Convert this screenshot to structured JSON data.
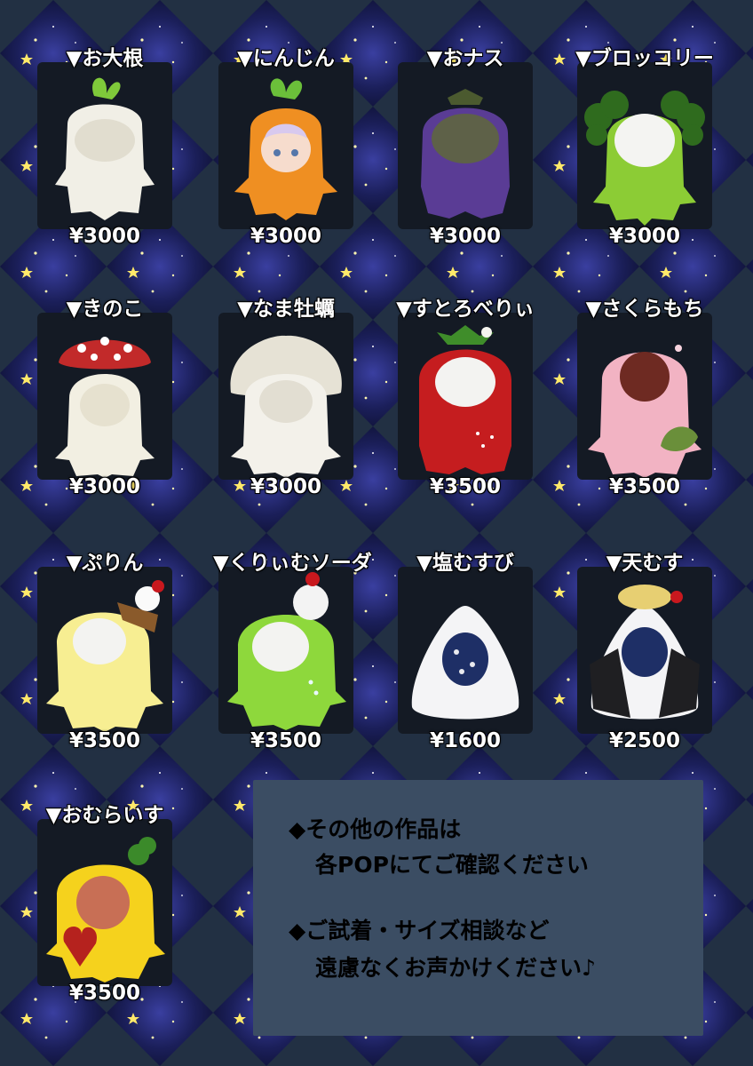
{
  "colors": {
    "background": "#223043",
    "sky": "#1b1f5a",
    "panel": "#3b4d63"
  },
  "items": [
    {
      "name": "▼お大根",
      "price": "¥3000",
      "color": "#f1efe6",
      "accent": "#7fc93a"
    },
    {
      "name": "▼にんじん",
      "price": "¥3000",
      "color": "#ef8f22",
      "accent": "#6bbf3a"
    },
    {
      "name": "▼おナス",
      "price": "¥3000",
      "color": "#5a3c95",
      "accent": "#4b5a2f"
    },
    {
      "name": "▼ブロッコリー",
      "price": "¥3000",
      "color": "#8ccc35",
      "accent": "#2f6b1e"
    },
    {
      "name": "▼きのこ",
      "price": "¥3000",
      "color": "#f2efe2",
      "accent": "#c22a2a"
    },
    {
      "name": "▼なま牡蠣",
      "price": "¥3000",
      "color": "#f3f1ea",
      "accent": "#e6e2d5"
    },
    {
      "name": "▼すとろべりぃ",
      "price": "¥3500",
      "color": "#c51d1f",
      "accent": "#3f8d2a"
    },
    {
      "name": "▼さくらもち",
      "price": "¥3500",
      "color": "#f2b3c3",
      "accent": "#6a8f3a"
    },
    {
      "name": "▼ぷりん",
      "price": "¥3500",
      "color": "#f7ee92",
      "accent": "#8a5a2b"
    },
    {
      "name": "▼くりぃむソーダ",
      "price": "¥3500",
      "color": "#8ed83c",
      "accent": "#f3f3f3"
    },
    {
      "name": "▼塩むすび",
      "price": "¥1600",
      "color": "#f4f4f6",
      "accent": "#1e2f66"
    },
    {
      "name": "▼天むす",
      "price": "¥2500",
      "color": "#f4f4f6",
      "accent": "#1f1f22"
    },
    {
      "name": "▼おむらいす",
      "price": "¥3500",
      "color": "#f5d21d",
      "accent": "#b5221e"
    }
  ],
  "info": {
    "line1": "◆その他の作品は",
    "line2": "各POPにてご確認ください",
    "line3": "◆ご試着・サイズ相談など",
    "line4": "遠慮なくお声かけください♪"
  }
}
